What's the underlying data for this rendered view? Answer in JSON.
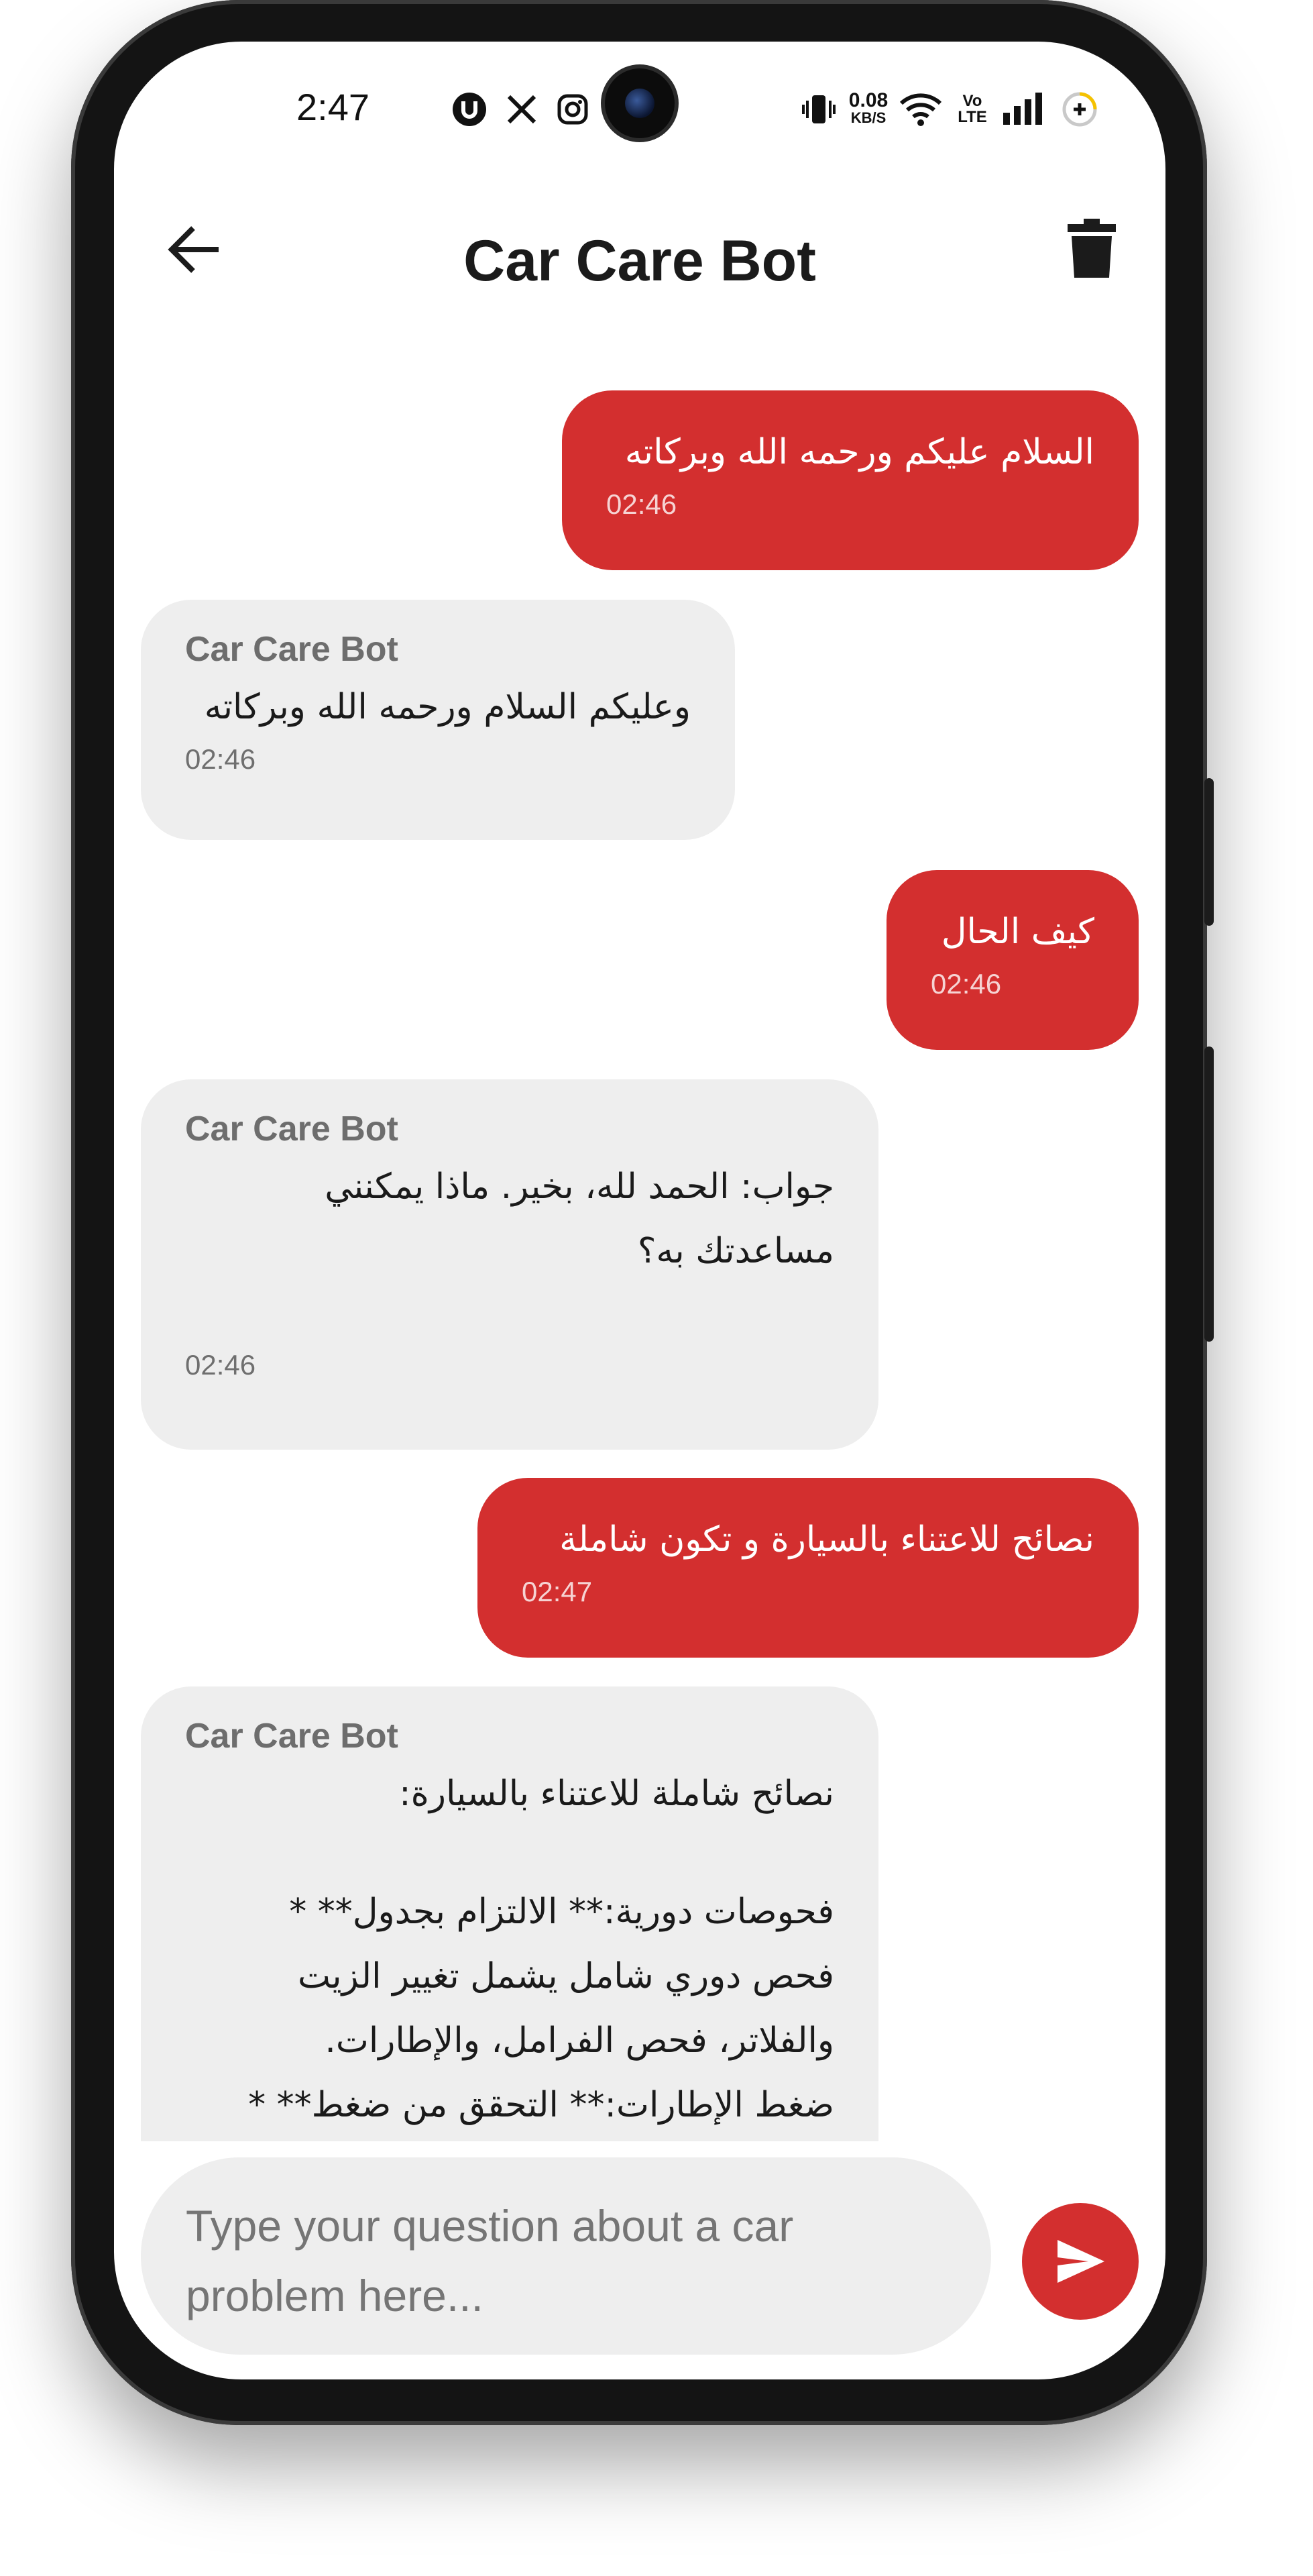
{
  "status_bar": {
    "time": "2:47",
    "net_speed_value": "0.08",
    "net_speed_unit": "KB/S",
    "volte": "Vo LTE"
  },
  "app_bar": {
    "title": "Car Care Bot"
  },
  "messages": [
    {
      "role": "user",
      "text": "السلام عليكم ورحمه الله وبركاته",
      "time": "02:46"
    },
    {
      "role": "bot",
      "sender": "Car Care Bot",
      "text": "وعليكم السلام ورحمه الله وبركاته",
      "time": "02:46"
    },
    {
      "role": "user",
      "text": "كيف الحال",
      "time": "02:46"
    },
    {
      "role": "bot",
      "sender": "Car Care Bot",
      "lines": [
        "جواب: الحمد لله، بخير.  ماذا يمكنني",
        "مساعدتك به؟"
      ],
      "time": "02:46"
    },
    {
      "role": "user",
      "text": "نصائح للاعتناء بالسيارة و تكون شاملة",
      "time": "02:47"
    },
    {
      "role": "bot",
      "sender": "Car Care Bot",
      "lines": [
        "نصائح شاملة للاعتناء بالسيارة:",
        "",
        "فحوصات دورية:**  الالتزام بجدول** *",
        "فحص دوري شامل يشمل تغيير الزيت",
        "والفلاتر، فحص الفرامل، والإطارات.",
        "ضغط الإطارات:**  التحقق من ضغط** *"
      ]
    }
  ],
  "input": {
    "placeholder": "Type your question about a car problem here..."
  },
  "colors": {
    "accent": "#d32f2f",
    "bot_bubble": "#eeeeee",
    "background": "#ffffff"
  }
}
